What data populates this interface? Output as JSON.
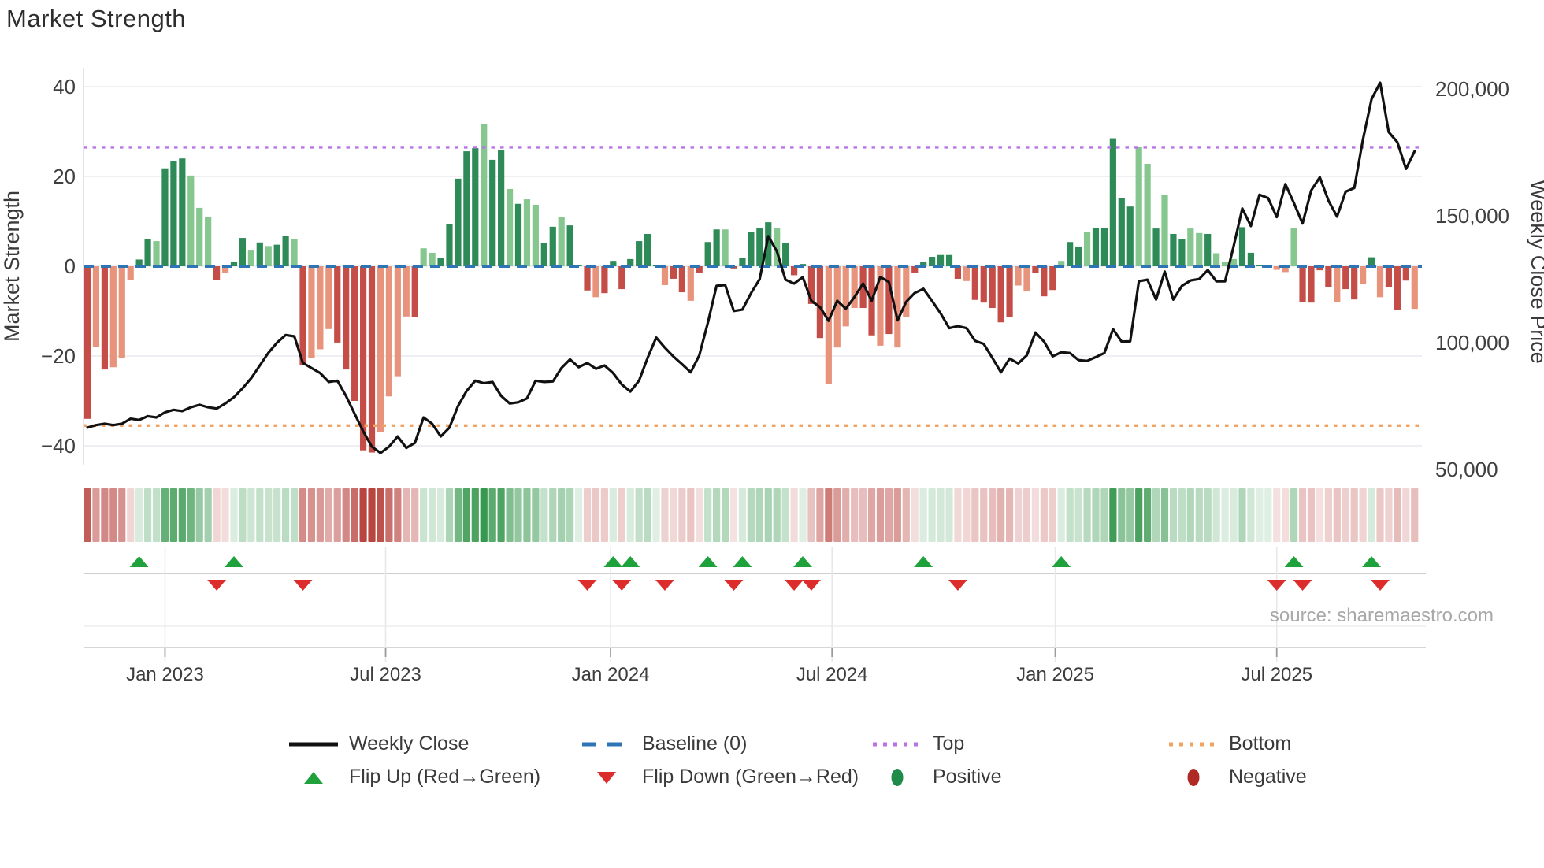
{
  "title": "Market Strength",
  "source": "source: sharemaestro.com",
  "axes": {
    "left_title": "Market Strength",
    "right_title": "Weekly Close Price",
    "left_ticks": [
      {
        "label": "40",
        "value": 40
      },
      {
        "label": "20",
        "value": 20
      },
      {
        "label": "0",
        "value": 0
      },
      {
        "label": "−20",
        "value": -20
      },
      {
        "label": "−40",
        "value": -40
      }
    ],
    "right_ticks": [
      {
        "label": "200,000",
        "value": 200000
      },
      {
        "label": "150,000",
        "value": 150000
      },
      {
        "label": "100,000",
        "value": 100000
      },
      {
        "label": "50,000",
        "value": 50000
      }
    ],
    "x_ticks": [
      {
        "label": "Jan 2023",
        "week": 10
      },
      {
        "label": "Jul 2023",
        "week": 35.6
      },
      {
        "label": "Jan 2024",
        "week": 61.7
      },
      {
        "label": "Jul 2024",
        "week": 87.4
      },
      {
        "label": "Jan 2025",
        "week": 113.3
      },
      {
        "label": "Jul 2025",
        "week": 139.0
      }
    ]
  },
  "legend": {
    "items": [
      {
        "label": "Weekly Close",
        "kind": "line"
      },
      {
        "label": "Baseline (0)",
        "kind": "dashed"
      },
      {
        "label": "Top",
        "kind": "dotted-purple"
      },
      {
        "label": "Bottom",
        "kind": "dotted-orange"
      },
      {
        "label": "Flip Up (Red→Green)",
        "kind": "triangle-up"
      },
      {
        "label": "Flip Down (Green→Red)",
        "kind": "triangle-down"
      },
      {
        "label": "Positive",
        "kind": "dot-green"
      },
      {
        "label": "Negative",
        "kind": "dot-red"
      }
    ]
  },
  "colors": {
    "bar_dark_green": "#2e8b57",
    "bar_light_green": "#86c68f",
    "bar_dark_red": "#c44d48",
    "bar_light_red": "#e8947c",
    "baseline_blue": "#2e75b6",
    "top_purple": "#b873e8",
    "bottom_orange": "#f2a361",
    "price_line": "#111111",
    "flip_up_green": "#1fa23c",
    "flip_down_red": "#dc2c2c",
    "positive_dot": "#1e8b4a",
    "negative_dot": "#b02a25",
    "heat_green": "#37984f",
    "heat_red": "#b94540",
    "grid": "#e9e9ef",
    "tick_text": "#3f3f3f",
    "source_text": "#a8a8a8"
  },
  "chart_data": {
    "type": "combo-bar-line-heatmap",
    "weeks": 155,
    "title": "Market Strength",
    "left_ylabel": "Market Strength",
    "right_ylabel": "Weekly Close Price",
    "left_ylim": [
      -44,
      44
    ],
    "right_ylim": [
      50000,
      207000
    ],
    "baseline": 0,
    "top_level": 26.5,
    "bottom_level": -35.5,
    "strength": [
      -34,
      -18,
      -23,
      -22.5,
      -20.5,
      -3,
      1.5,
      6,
      5.6,
      21.8,
      23.5,
      24,
      20.2,
      13,
      11,
      -3,
      -1.5,
      1,
      6.3,
      3.5,
      5.3,
      4.5,
      4.8,
      6.8,
      6,
      -22,
      -20.5,
      -18.5,
      -14,
      -17,
      -23,
      -30,
      -41,
      -41.5,
      -37,
      -29,
      -24.5,
      -11.2,
      -11.4,
      4,
      3,
      1.8,
      9.3,
      19.5,
      25.6,
      26.3,
      31.6,
      23.7,
      25.8,
      17.2,
      13.9,
      14.9,
      13.7,
      5.1,
      8.8,
      10.9,
      9.1,
      0.3,
      -5.4,
      -6.9,
      -6,
      1.2,
      -5.1,
      1.6,
      5.6,
      7.2,
      0.2,
      -4.2,
      -2.8,
      -5.8,
      -7.7,
      -1.4,
      5.4,
      8.2,
      8.2,
      -0.5,
      1.9,
      7.7,
      8.6,
      9.8,
      8.6,
      5.1,
      -2,
      0.5,
      -8.4,
      -16,
      -26.2,
      -18.1,
      -13.4,
      -9.3,
      -9.3,
      -15.4,
      -17.7,
      -15.1,
      -18.1,
      -11.3,
      -1.4,
      1,
      2.1,
      2.5,
      2.5,
      -2.8,
      -3.3,
      -7.5,
      -8.1,
      -9.3,
      -12.5,
      -11.3,
      -4.3,
      -5.5,
      -1.5,
      -6.7,
      -5.3,
      1.2,
      5.4,
      4.4,
      7.6,
      8.6,
      8.6,
      28.5,
      15.1,
      13.3,
      26.5,
      22.8,
      8.4,
      15.9,
      7.2,
      6.1,
      8.4,
      7.4,
      7.2,
      2.9,
      1,
      1.6,
      8.7,
      3,
      0.3,
      0.3,
      -0.8,
      -1.3,
      8.6,
      -7.9,
      -8.1,
      -0.9,
      -4.7,
      -7.9,
      -5.1,
      -7.4,
      -3.9,
      2,
      -6.9,
      -4.6,
      -9.8,
      -3.2,
      -9.5
    ],
    "shade": "dldlllddldddllldlddldlddldllldddddlllldlldddddlddldllddldddldddddddlddldddldddddldddddllllddldllddddddldddddlldddlddldddddlldlddlldllldddllllddddlddldldddlll",
    "close": [
      66500,
      67500,
      68000,
      67500,
      68000,
      70000,
      69500,
      71000,
      70500,
      72500,
      73500,
      73000,
      74500,
      75500,
      74500,
      74000,
      76000,
      78500,
      82000,
      86000,
      91000,
      96000,
      100000,
      103000,
      102500,
      92000,
      90000,
      88000,
      84500,
      85000,
      79000,
      72000,
      65000,
      59000,
      56500,
      59000,
      63000,
      58500,
      60500,
      70500,
      68000,
      63000,
      66500,
      75000,
      81000,
      85000,
      84000,
      84500,
      79000,
      76000,
      76500,
      78000,
      85000,
      84500,
      84700,
      90000,
      93400,
      90300,
      92000,
      89700,
      91000,
      88000,
      83500,
      80700,
      85000,
      94000,
      102000,
      98000,
      94500,
      91500,
      88300,
      95000,
      108000,
      122400,
      122700,
      112500,
      113000,
      119500,
      125000,
      142000,
      136000,
      124800,
      123300,
      125800,
      116500,
      114000,
      108600,
      116500,
      113400,
      118000,
      123300,
      116500,
      125900,
      123900,
      108800,
      116100,
      119600,
      121200,
      116500,
      111500,
      105700,
      106500,
      105700,
      100700,
      99500,
      94000,
      88300,
      93700,
      91800,
      95000,
      104000,
      100400,
      94600,
      96200,
      95900,
      93100,
      92800,
      94300,
      95900,
      105300,
      100400,
      100500,
      124200,
      124800,
      117000,
      128000,
      117000,
      122400,
      124500,
      125100,
      128600,
      124200,
      124200,
      138000,
      152900,
      146000,
      158300,
      157000,
      149500,
      162500,
      155000,
      147000,
      160000,
      165200,
      156000,
      149700,
      159500,
      161000,
      180000,
      196000,
      202500,
      183000,
      179000,
      168500,
      175500
    ],
    "flip_up_weeks": [
      7,
      18,
      62,
      64,
      73,
      77,
      84,
      98,
      114,
      141,
      150
    ],
    "flip_down_weeks": [
      16,
      26,
      59,
      63,
      68,
      76,
      83,
      85,
      102,
      139,
      142,
      151
    ]
  }
}
